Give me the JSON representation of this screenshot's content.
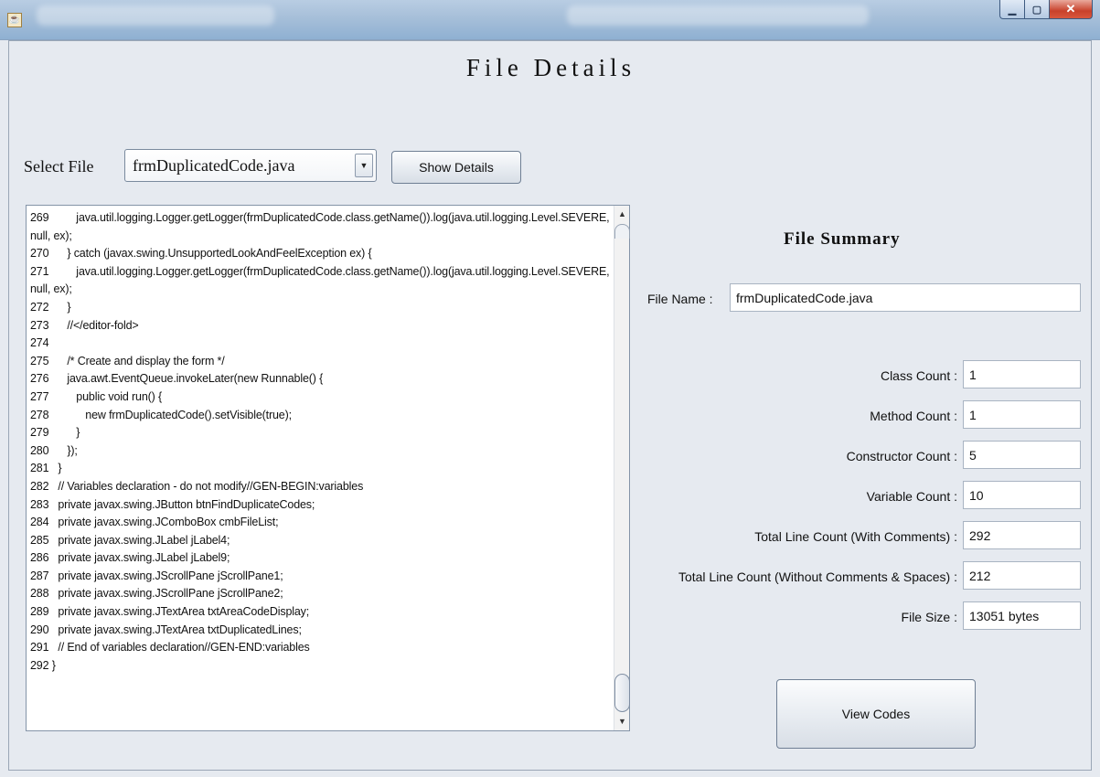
{
  "window": {
    "icon": "java-icon"
  },
  "page": {
    "title": "File Details"
  },
  "select": {
    "label": "Select File",
    "value": "frmDuplicatedCode.java"
  },
  "buttons": {
    "show_details": "Show Details",
    "view_codes": "View Codes"
  },
  "code": {
    "lines": [
      "269         java.util.logging.Logger.getLogger(frmDuplicatedCode.class.getName()).log(java.util.logging.Level.SEVERE, null, ex);",
      "270      } catch (javax.swing.UnsupportedLookAndFeelException ex) {",
      "271         java.util.logging.Logger.getLogger(frmDuplicatedCode.class.getName()).log(java.util.logging.Level.SEVERE, null, ex);",
      "272      }",
      "273      //</editor-fold>",
      "274",
      "275      /* Create and display the form */",
      "276      java.awt.EventQueue.invokeLater(new Runnable() {",
      "277         public void run() {",
      "278            new frmDuplicatedCode().setVisible(true);",
      "279         }",
      "280      });",
      "281   }",
      "282   // Variables declaration - do not modify//GEN-BEGIN:variables",
      "283   private javax.swing.JButton btnFindDuplicateCodes;",
      "284   private javax.swing.JComboBox cmbFileList;",
      "285   private javax.swing.JLabel jLabel4;",
      "286   private javax.swing.JLabel jLabel9;",
      "287   private javax.swing.JScrollPane jScrollPane1;",
      "288   private javax.swing.JScrollPane jScrollPane2;",
      "289   private javax.swing.JTextArea txtAreaCodeDisplay;",
      "290   private javax.swing.JTextArea txtDuplicatedLines;",
      "291   // End of variables declaration//GEN-END:variables",
      "292 }"
    ]
  },
  "summary": {
    "title": "File Summary",
    "file_name_label": "File Name :",
    "file_name_value": "frmDuplicatedCode.java",
    "rows": [
      {
        "label": "Class Count :",
        "value": "1"
      },
      {
        "label": "Method Count :",
        "value": "1"
      },
      {
        "label": "Constructor Count :",
        "value": "5"
      },
      {
        "label": "Variable Count :",
        "value": "10"
      },
      {
        "label": "Total Line Count (With Comments) :",
        "value": "292"
      },
      {
        "label": "Total Line Count (Without Comments & Spaces) :",
        "value": "212"
      },
      {
        "label": "File Size :",
        "value": "13051 bytes"
      }
    ]
  }
}
